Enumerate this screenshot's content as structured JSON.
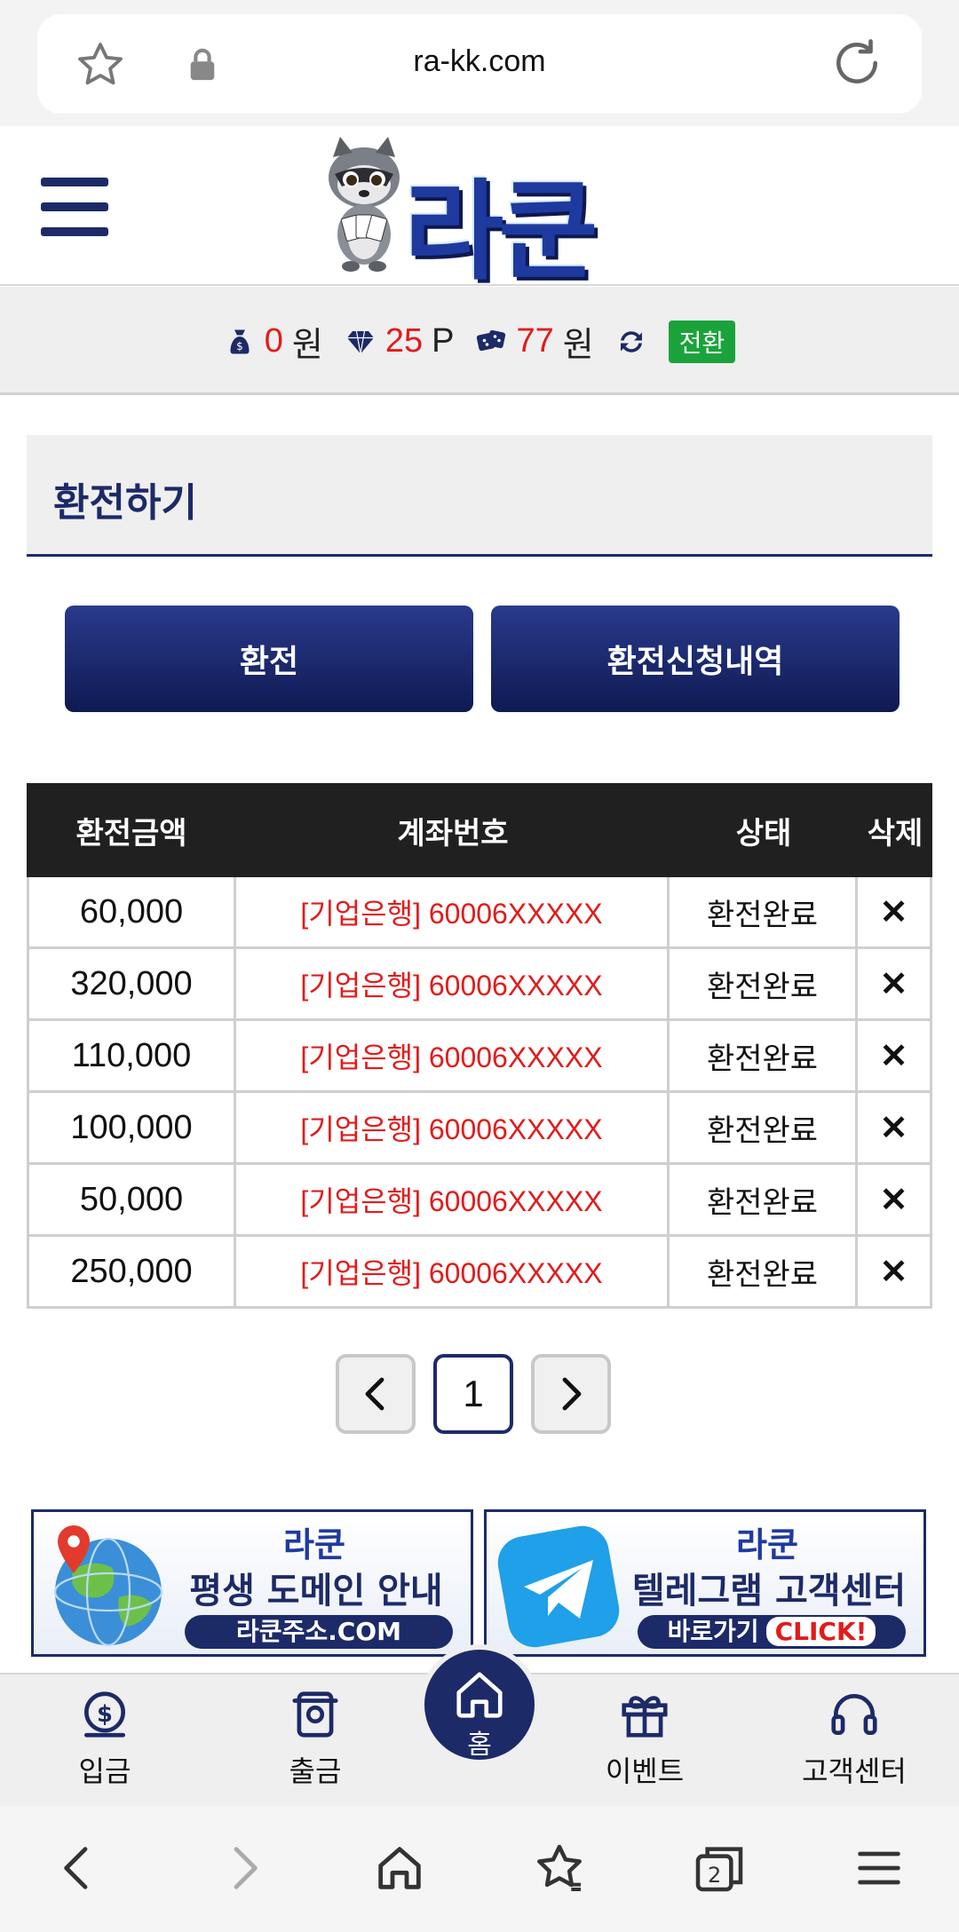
{
  "browser": {
    "url": "ra-kk.com",
    "icons": [
      "star-icon",
      "lock-icon",
      "reload-icon"
    ]
  },
  "header": {
    "logo_text": "라쿤",
    "menu_icon": "hamburger-icon"
  },
  "balance": {
    "money_value": "0",
    "money_unit": "원",
    "point_value": "25",
    "point_unit": "P",
    "casino_value": "77",
    "casino_unit": "원",
    "convert_label": "전환"
  },
  "section": {
    "title": "환전하기"
  },
  "tabs": {
    "exchange": "환전",
    "history": "환전신청내역"
  },
  "table": {
    "headers": [
      "환전금액",
      "계좌번호",
      "상태",
      "삭제"
    ],
    "rows": [
      {
        "amount": "60,000",
        "account": "[기업은행] 60006XXXXX",
        "status": "환전완료",
        "delete": "✕"
      },
      {
        "amount": "320,000",
        "account": "[기업은행] 60006XXXXX",
        "status": "환전완료",
        "delete": "✕"
      },
      {
        "amount": "110,000",
        "account": "[기업은행] 60006XXXXX",
        "status": "환전완료",
        "delete": "✕"
      },
      {
        "amount": "100,000",
        "account": "[기업은행] 60006XXXXX",
        "status": "환전완료",
        "delete": "✕"
      },
      {
        "amount": "50,000",
        "account": "[기업은행] 60006XXXXX",
        "status": "환전완료",
        "delete": "✕"
      },
      {
        "amount": "250,000",
        "account": "[기업은행] 60006XXXXX",
        "status": "환전완료",
        "delete": "✕"
      }
    ]
  },
  "pagination": {
    "prev": "‹",
    "current": "1",
    "next": "›"
  },
  "banners": {
    "left": {
      "logo": "라쿤",
      "title": "평생 도메인 안내",
      "sub": "라쿤주소.COM"
    },
    "right": {
      "logo": "라쿤",
      "title": "텔레그램 고객센터",
      "sub": "바로가기",
      "click": "CLICK!"
    }
  },
  "bottom_nav": {
    "deposit": "입금",
    "withdraw": "출금",
    "home": "홈",
    "event": "이벤트",
    "support": "고객센터"
  },
  "colors": {
    "navy": "#1c2a68",
    "red": "#e21b1b",
    "green": "#1aa33b"
  }
}
